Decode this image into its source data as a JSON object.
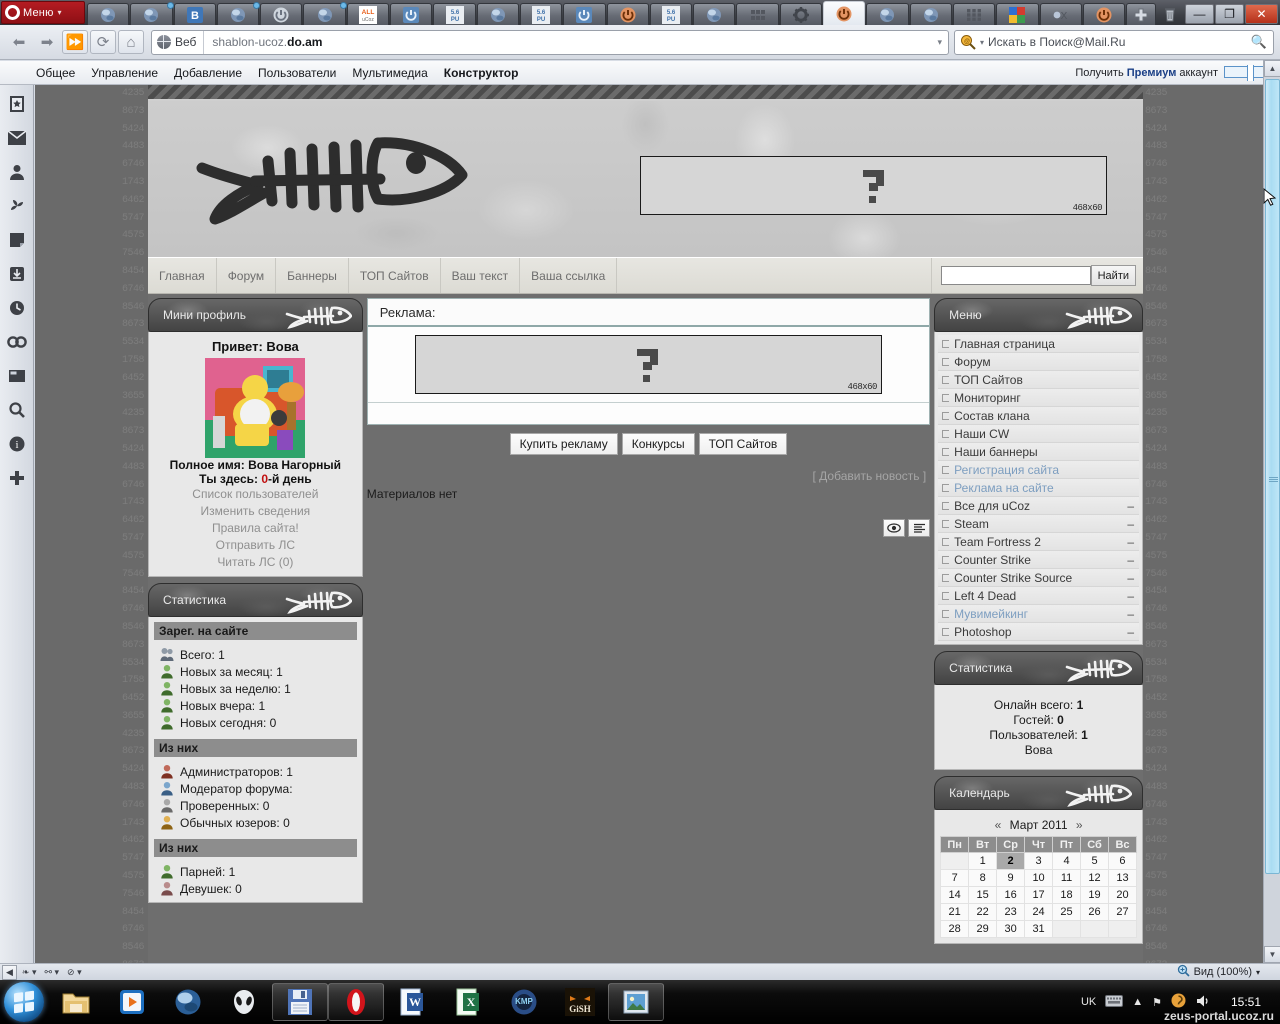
{
  "browser": {
    "menu_button": "Меню",
    "address": {
      "badge": "Веб",
      "url_prefix": "shablon-ucoz.",
      "url_bold": "do.am"
    },
    "search": {
      "placeholder": "Искать в Поиск@Mail.Ru"
    },
    "window_controls": {
      "minimize": "—",
      "maximize": "❐",
      "close": "✕"
    },
    "status": {
      "zoom": "Вид (100%)"
    },
    "tabs_count": 24,
    "active_tab_index": 17
  },
  "adminbar": {
    "items": [
      {
        "label": "Общее",
        "active": false
      },
      {
        "label": "Управление",
        "active": false
      },
      {
        "label": "Добавление",
        "active": false
      },
      {
        "label": "Пользователи",
        "active": false
      },
      {
        "label": "Мультимедиа",
        "active": false
      },
      {
        "label": "Конструктор",
        "active": true
      }
    ],
    "premium_pre": "Получить ",
    "premium_bold": "Премиум",
    "premium_post": " аккаунт"
  },
  "sidepanel": {
    "icons": [
      "bookmarks-icon",
      "mail-icon",
      "contacts-icon",
      "feeds-icon",
      "notes-icon",
      "downloads-icon",
      "history-icon",
      "links-icon",
      "widgets-icon",
      "search-icon",
      "info-icon",
      "add-icon"
    ]
  },
  "site": {
    "banner_size_label": "468x60",
    "nav": [
      "Главная",
      "Форум",
      "Баннеры",
      "ТОП Сайтов",
      "Ваш текст",
      "Ваша ссылка"
    ],
    "search": {
      "value": "",
      "button": "Найти"
    }
  },
  "miniprofile": {
    "title": "Мини профиль",
    "greeting": "Привет: Вова",
    "fullname_label": "Полное имя: Вова Нагорный",
    "here_pre": "Ты здесь: ",
    "here_num": "0",
    "here_post": "-й день",
    "links": [
      "Список пользователей",
      "Изменить сведения",
      "Правила сайта!",
      "Отправить ЛС",
      "Читать ЛС (0)"
    ]
  },
  "statistics_left": {
    "title": "Статистика",
    "groups": [
      {
        "header": "Зарег. на сайте",
        "rows": [
          {
            "icon": "users-group-icon",
            "label": "Всего: 1"
          },
          {
            "icon": "user-green-icon",
            "label": "Новых за месяц: 1"
          },
          {
            "icon": "user-green-icon",
            "label": "Новых за неделю: 1"
          },
          {
            "icon": "user-green-icon",
            "label": "Новых вчера: 1"
          },
          {
            "icon": "user-green-icon",
            "label": "Новых сегодня: 0"
          }
        ]
      },
      {
        "header": "Из них",
        "rows": [
          {
            "icon": "user-red-icon",
            "label": "Администраторов: 1"
          },
          {
            "icon": "user-blue-icon",
            "label": "Модератор форума:"
          },
          {
            "icon": "user-grey-icon",
            "label": "Проверенных: 0"
          },
          {
            "icon": "user-orange-icon",
            "label": "Обычных юзеров: 0"
          }
        ]
      },
      {
        "header": "Из них",
        "rows": [
          {
            "icon": "user-green-icon",
            "label": "Парней: 1"
          },
          {
            "icon": "user-pink-icon",
            "label": "Девушек: 0"
          }
        ]
      }
    ]
  },
  "center": {
    "ad_block_title": "Реклама:",
    "buttons": [
      "Купить рекламу",
      "Конкурсы",
      "ТОП Сайтов"
    ],
    "add_news": "[ Добавить новость ]",
    "no_materials": "Материалов нет",
    "footer_icons": [
      "eye-icon",
      "list-icon"
    ]
  },
  "menu_right": {
    "title": "Меню",
    "items": [
      {
        "label": "Главная страница",
        "blue": false,
        "dash": false
      },
      {
        "label": "Форум",
        "blue": false,
        "dash": false
      },
      {
        "label": "ТОП Сайтов",
        "blue": false,
        "dash": false
      },
      {
        "label": "Мониторинг",
        "blue": false,
        "dash": false
      },
      {
        "label": "Состав клана",
        "blue": false,
        "dash": false
      },
      {
        "label": "Наши CW",
        "blue": false,
        "dash": false
      },
      {
        "label": "Наши баннеры",
        "blue": false,
        "dash": false
      },
      {
        "label": "Регистрация сайта",
        "blue": true,
        "dash": false
      },
      {
        "label": "Реклама на сайте",
        "blue": true,
        "dash": false
      },
      {
        "label": "Все для uCoz",
        "blue": false,
        "dash": true
      },
      {
        "label": "Steam",
        "blue": false,
        "dash": true
      },
      {
        "label": "Team Fortress 2",
        "blue": false,
        "dash": true
      },
      {
        "label": "Counter Strike",
        "blue": false,
        "dash": true
      },
      {
        "label": "Counter Strike Source",
        "blue": false,
        "dash": true
      },
      {
        "label": "Left 4 Dead",
        "blue": false,
        "dash": true
      },
      {
        "label": "Мувимейкинг",
        "blue": true,
        "dash": true
      },
      {
        "label": "Photoshop",
        "blue": false,
        "dash": true
      }
    ]
  },
  "statistics_right": {
    "title": "Статистика",
    "lines": [
      {
        "label": "Онлайн всего: ",
        "value": "1"
      },
      {
        "label": "Гостей: ",
        "value": "0"
      },
      {
        "label": "Пользователей: ",
        "value": "1"
      }
    ],
    "user": "Вова"
  },
  "calendar": {
    "title": "Календарь",
    "prev": "«",
    "next": "»",
    "month_label": "Март 2011",
    "weekdays": [
      "Пн",
      "Вт",
      "Ср",
      "Чт",
      "Пт",
      "Сб",
      "Вс"
    ],
    "weeks": [
      [
        "",
        "1",
        "2",
        "3",
        "4",
        "5",
        "6"
      ],
      [
        "7",
        "8",
        "9",
        "10",
        "11",
        "12",
        "13"
      ],
      [
        "14",
        "15",
        "16",
        "17",
        "18",
        "19",
        "20"
      ],
      [
        "21",
        "22",
        "23",
        "24",
        "25",
        "26",
        "27"
      ],
      [
        "28",
        "29",
        "30",
        "31",
        "",
        "",
        ""
      ]
    ],
    "today": "2"
  },
  "taskbar": {
    "apps": [
      "explorer-icon",
      "media-player-icon",
      "opera-globe-icon",
      "alien-icon",
      "floppy-save-icon",
      "opera-red-icon",
      "word-icon",
      "excel-icon",
      "kmplayer-icon",
      "gish-icon",
      "photo-viewer-icon"
    ],
    "tray": {
      "language": "UK",
      "keyboard": "keyboard-icon",
      "time": "15:51"
    },
    "watermark": "zeus-portal.ucoz.ru"
  }
}
